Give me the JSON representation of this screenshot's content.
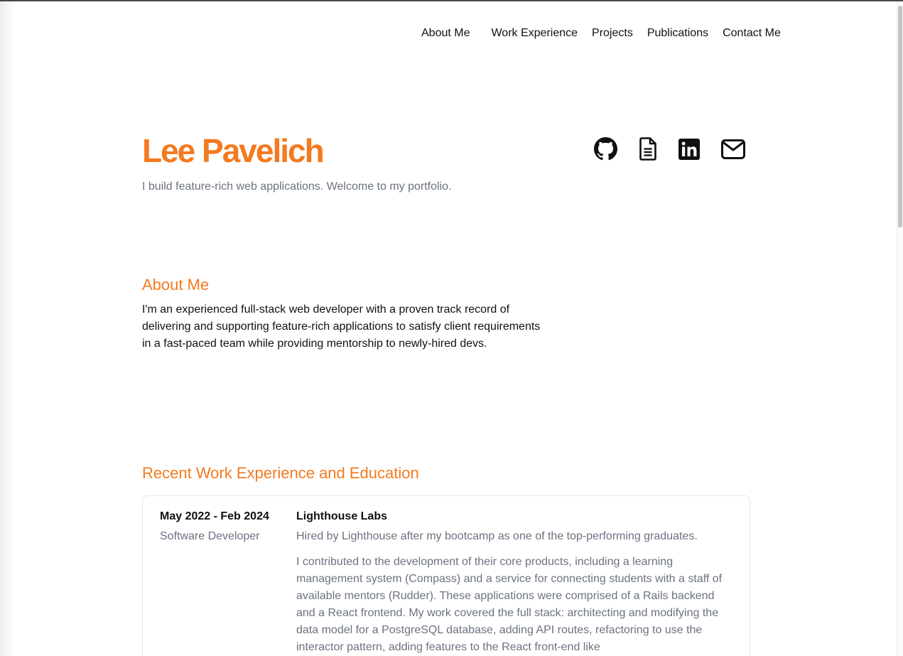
{
  "nav": {
    "items": [
      "About Me",
      "Work Experience",
      "Projects",
      "Publications",
      "Contact Me"
    ]
  },
  "hero": {
    "name": "Lee Pavelich",
    "subtitle": "I build feature-rich web applications. Welcome to my portfolio."
  },
  "social_icons": [
    "github-icon",
    "resume-document-icon",
    "linkedin-icon",
    "email-icon"
  ],
  "about": {
    "heading": "About Me",
    "text": "I'm an experienced full-stack web developer with a proven track record of delivering and supporting feature-rich applications to satisfy client requirements in a fast-paced team while providing mentorship to newly-hired devs."
  },
  "work": {
    "heading": "Recent Work Experience and Education",
    "entries": [
      {
        "dates": "May 2022 - Feb 2024",
        "role": "Software Developer",
        "organization": "Lighthouse Labs",
        "summary": "Hired by Lighthouse after my bootcamp as one of the top-performing graduates.",
        "details": "I contributed to the development of their core products, including a learning management system (Compass) and a service for connecting students with a staff of available mentors (Rudder). These applications were comprised of a Rails backend and a React frontend. My work covered the full stack: architecting and modifying the data model for a PostgreSQL database, adding API routes, refactoring to use the interactor pattern, adding features to the React front-end like"
      }
    ]
  },
  "colors": {
    "accent": "#f47a1f",
    "text": "#111111",
    "muted": "#6b7280",
    "border": "#e5e7eb"
  }
}
